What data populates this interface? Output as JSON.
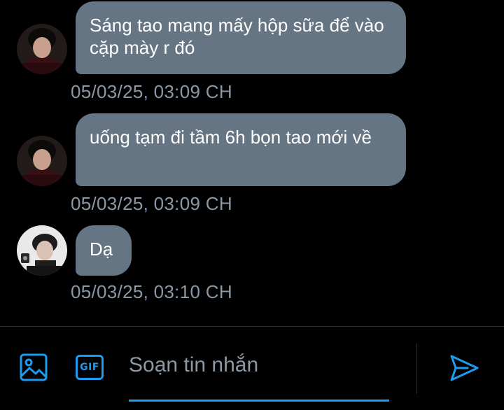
{
  "theme": {
    "background": "#000000",
    "bubble": "#657583",
    "bubble_text": "#ffffff",
    "timestamp": "#8b98a5",
    "accent": "#1d9bf0",
    "border": "#2f3336"
  },
  "messages": [
    {
      "sender_avatar": "avatar-dark-hair-icon",
      "text": "Sáng tao mang mấy hộp sữa để vào cặp mày r đó",
      "timestamp": "05/03/25, 03:09 CH"
    },
    {
      "sender_avatar": "avatar-dark-hair-icon",
      "text": "uống tạm đi tầm 6h bọn tao mới về",
      "timestamp": "05/03/25, 03:09 CH"
    },
    {
      "sender_avatar": "avatar-light-bg-icon",
      "text": "Dạ",
      "timestamp": "05/03/25, 03:10 CH"
    }
  ],
  "composer": {
    "image_icon": "image-icon",
    "gif_label": "GIF",
    "placeholder": "Soạn tin nhắn",
    "value": "",
    "send_icon": "send-icon"
  }
}
